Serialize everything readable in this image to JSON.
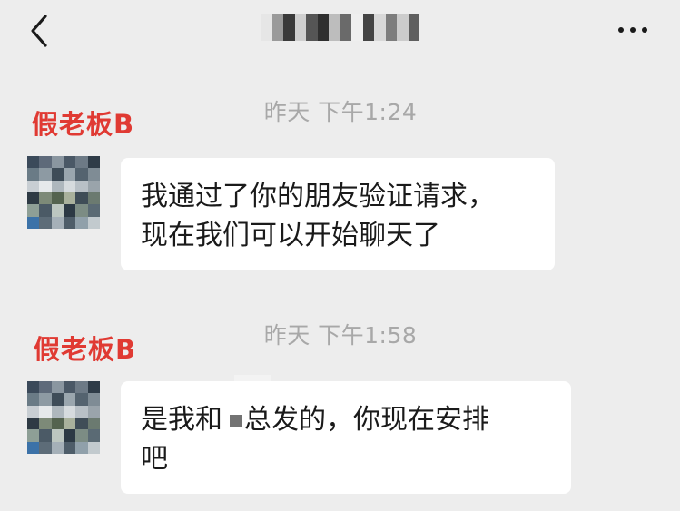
{
  "header": {
    "back_icon": "chevron-left-icon",
    "more_icon": "ellipsis-icon",
    "title_blur_colors": [
      "#e6e6e6",
      "#9a9a9a",
      "#3a3a3a",
      "#cfcfcf",
      "#555555",
      "#2f2f2f",
      "#bdbdbd",
      "#6a6a6a",
      "#efefef",
      "#444444",
      "#d8d8d8",
      "#7d7d7d",
      "#cccccc",
      "#5f5f5f"
    ]
  },
  "messages": [
    {
      "timestamp": "昨天 下午1:24",
      "sender": "假老板B",
      "text_lines": [
        "我通过了你的朋友验证请求，",
        "现在我们可以开始聊天了"
      ]
    },
    {
      "timestamp": "昨天 下午1:58",
      "sender": "假老板B",
      "text_part1": "是我和",
      "text_part2": "总发的，你现在安排",
      "text_line2": "吧"
    }
  ],
  "avatar_colors": [
    [
      "#3b4a5a",
      "#5e6a7a",
      "#8a96a0",
      "#4a5866",
      "#6d7a86",
      "#2f3c48"
    ],
    [
      "#6a7b86",
      "#8d9aa3",
      "#3e4c58",
      "#9aa6ae",
      "#54636f",
      "#7f8c95"
    ],
    [
      "#c8ced3",
      "#e6e9eb",
      "#aeb7bd",
      "#d6dbde",
      "#b8c0c6",
      "#9aa4ab"
    ],
    [
      "#2e3a44",
      "#7d8a78",
      "#54634f",
      "#a9b19c",
      "#3f4d57",
      "#6b7a70"
    ],
    [
      "#8e9f96",
      "#4b5a66",
      "#bcc6c0",
      "#2c3944",
      "#7c8c84",
      "#5a6a74"
    ],
    [
      "#3c72a8",
      "#5d6c78",
      "#a5b0b8",
      "#4e5d69",
      "#90a0aa",
      "#c2cace"
    ]
  ]
}
